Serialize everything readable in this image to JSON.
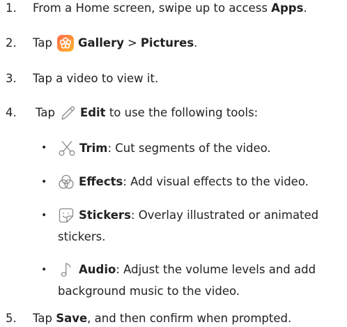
{
  "steps": [
    {
      "num": "1.",
      "pre": "From a Home screen, swipe up to access ",
      "bold": "Apps",
      "post": "."
    },
    {
      "num": "2.",
      "pre": "Tap",
      "app_name": "Gallery",
      "separator": ">",
      "bold2": "Pictures",
      "post": "."
    },
    {
      "num": "3.",
      "text": "Tap a video to view it."
    },
    {
      "num": "4.",
      "pre": "Tap",
      "bold": "Edit",
      "post": " to use the following tools:"
    },
    {
      "num": "5.",
      "pre": "Tap ",
      "bold": "Save",
      "post": ", and then confirm when prompted."
    }
  ],
  "tools": [
    {
      "icon": "scissors-icon",
      "name": "Trim",
      "desc": ": Cut segments of the video."
    },
    {
      "icon": "effects-icon",
      "name": "Effects",
      "desc": ": Add visual effects to the video."
    },
    {
      "icon": "sticker-icon",
      "name": "Stickers",
      "desc": ": Overlay illustrated or animated",
      "desc_line2": "stickers."
    },
    {
      "icon": "music-note-icon",
      "name": "Audio",
      "desc": ": Adjust the volume levels and add",
      "desc_line2": "background music to the video."
    }
  ],
  "bullet_char": "•",
  "colors": {
    "text": "#222222",
    "gallery_icon_from": "#ff7a45",
    "gallery_icon_to": "#ffb32a",
    "icon_stroke": "#8a8a8a"
  }
}
